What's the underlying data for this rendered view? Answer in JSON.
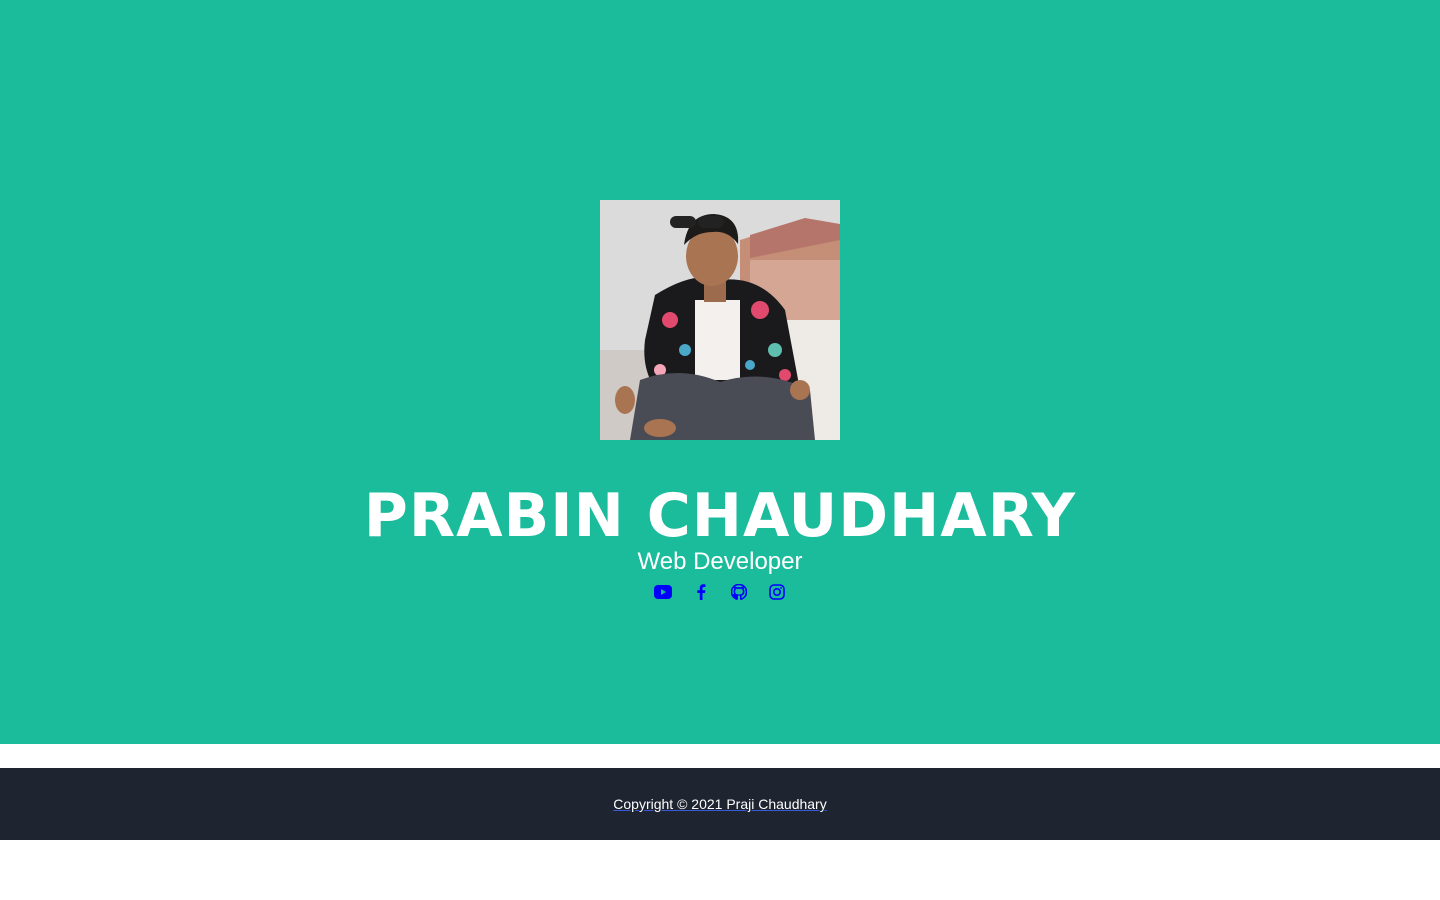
{
  "profile": {
    "name": "PRABIN CHAUDHARY",
    "role": "Web Developer"
  },
  "socials": [
    {
      "icon": "youtube-icon"
    },
    {
      "icon": "facebook-icon"
    },
    {
      "icon": "github-icon"
    },
    {
      "icon": "instagram-icon"
    }
  ],
  "footer": {
    "copyright": "Copyright © 2021 Praji Chaudhary"
  },
  "colors": {
    "hero_bg": "#1abc9c",
    "footer_bg": "#1e2430",
    "icon_color": "#0000ff",
    "text_color": "#ffffff"
  }
}
